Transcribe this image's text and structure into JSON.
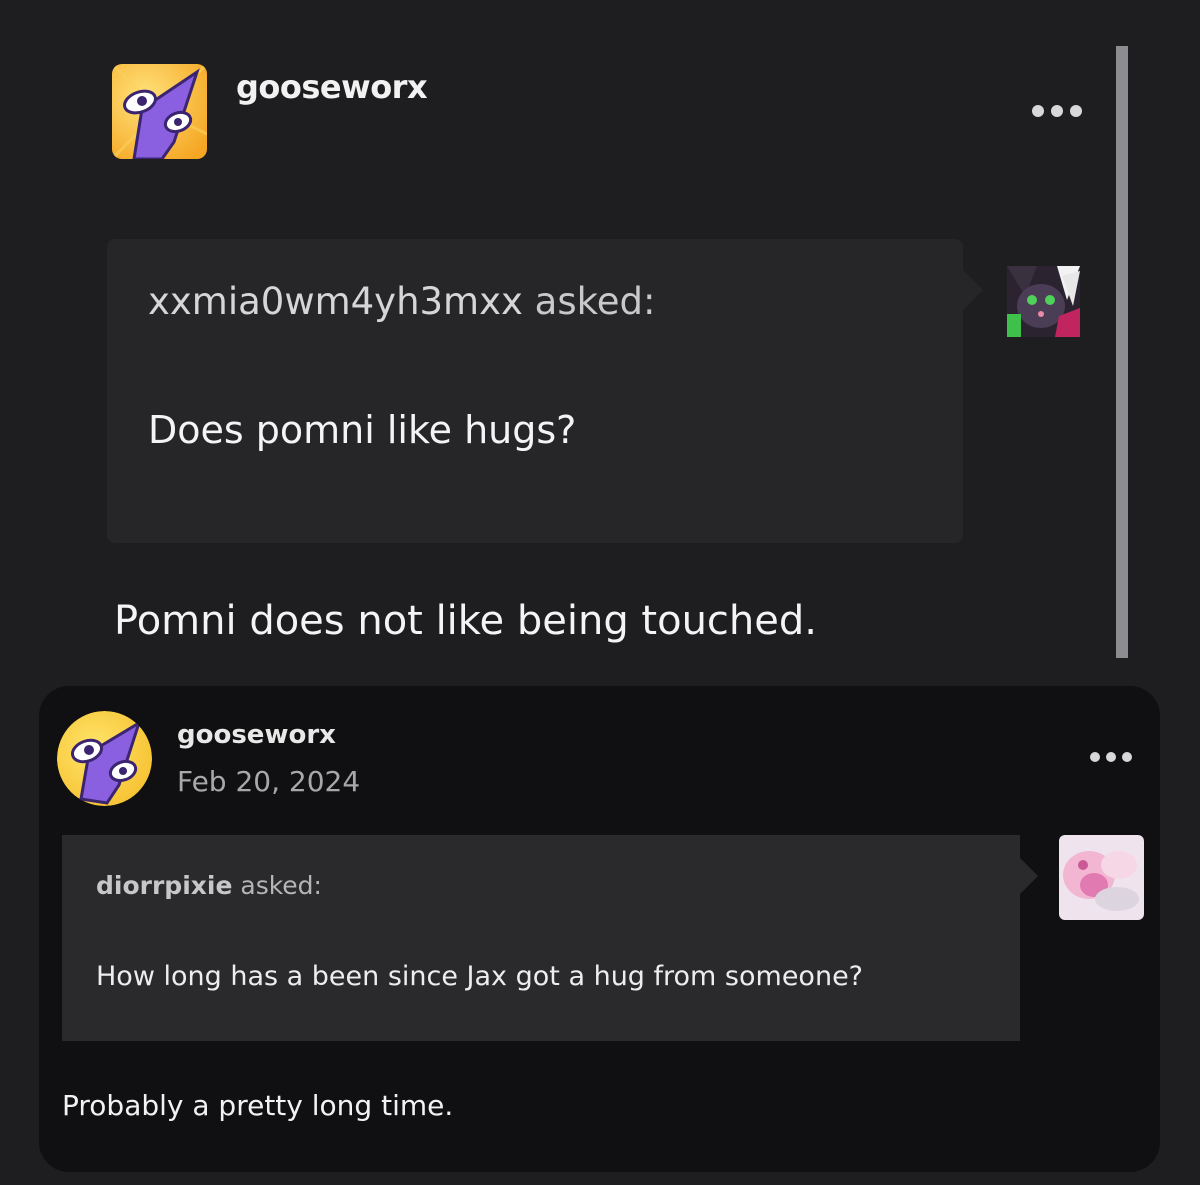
{
  "post1": {
    "username": "gooseworx",
    "menu_icon": "more-horizontal-icon",
    "ask": {
      "asker": "xxmia0wm4yh3mxx",
      "asked_label": "asked:",
      "question": "Does pomni like hugs?"
    },
    "answer": "Pomni does not like being touched."
  },
  "post2": {
    "username": "gooseworx",
    "date": "Feb 20, 2024",
    "menu_icon": "more-horizontal-icon",
    "ask": {
      "asker": "diorrpixie",
      "asked_label": "asked:",
      "question": "How long has a been since Jax got a hug from someone?"
    },
    "answer": "Probably a pretty long time."
  },
  "colors": {
    "background": "#1e1d20",
    "card": "#101012",
    "askbox": "#262528",
    "text": "#f4f4f4",
    "avatar_yellow": "#f6b637",
    "avatar_purple": "#8a5fe0"
  }
}
